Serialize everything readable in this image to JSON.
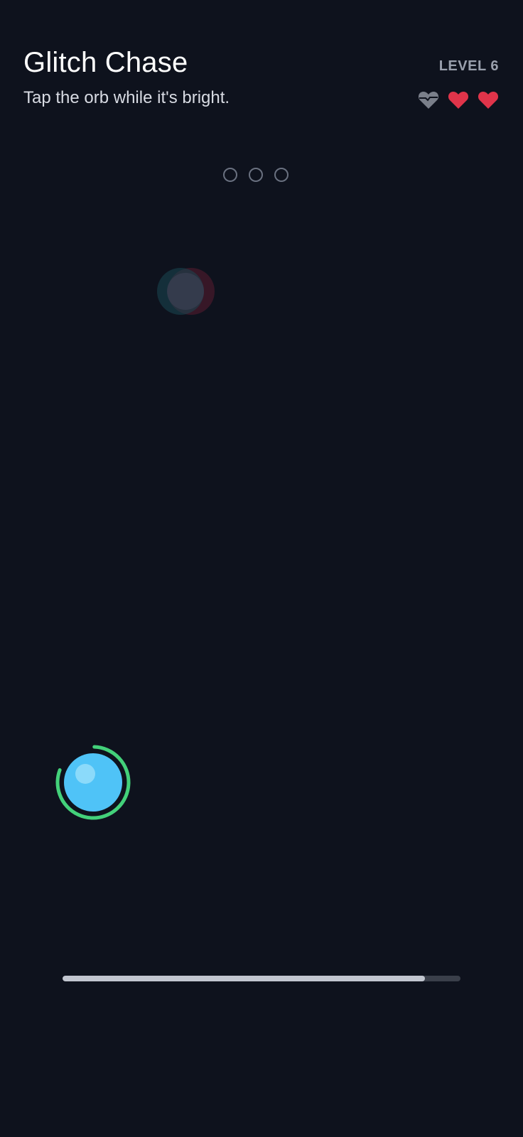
{
  "header": {
    "title": "Glitch Chase",
    "subtitle": "Tap the orb while it's bright.",
    "level": "LEVEL 6"
  },
  "lives": {
    "total": 3,
    "remaining": 2,
    "hearts": [
      {
        "state": "lost",
        "icon": "heart-broken-icon"
      },
      {
        "state": "full",
        "icon": "heart-icon"
      },
      {
        "state": "full",
        "icon": "heart-icon"
      }
    ]
  },
  "combo_dots": {
    "count": 3,
    "filled": 0
  },
  "orb": {
    "icon": "orb-icon",
    "color": "#4fc3f7",
    "timer_color": "#43d17a",
    "timer_remaining_fraction": 0.8
  },
  "ghost_orb": {
    "icon": "ghost-orb-icon"
  },
  "progress": {
    "fraction": 0.91
  },
  "colors": {
    "background": "#0e121d",
    "heart_full": "#e0344a",
    "heart_lost": "#7a7f8a",
    "timer_ring": "#43d17a",
    "orb": "#4fc3f7"
  }
}
